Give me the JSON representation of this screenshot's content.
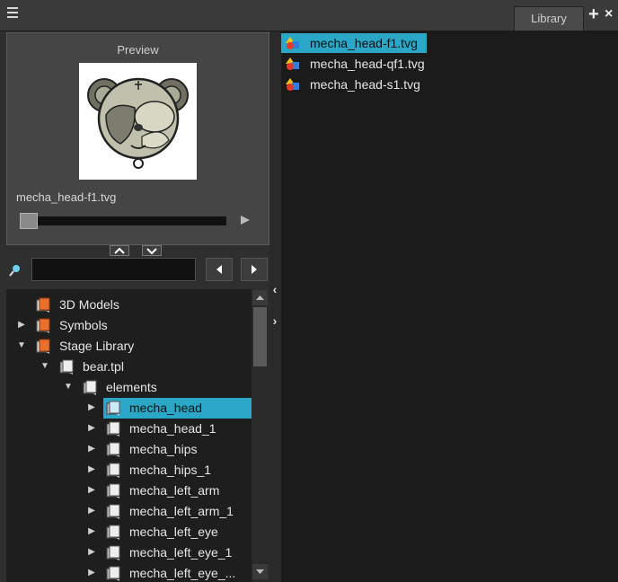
{
  "topbar": {
    "menu_icon": "hamburger-menu-icon",
    "tab_library": "Library",
    "add_label": "+",
    "close_label": "×"
  },
  "preview": {
    "title": "Preview",
    "filename": "mecha_head-f1.tvg",
    "scrubber_progress": 0.0
  },
  "search": {
    "value": "",
    "placeholder": ""
  },
  "tree": {
    "items": [
      {
        "label": "3D Models",
        "depth": 0,
        "expandable": false,
        "expanded": false,
        "icon": "folder-orange-icon",
        "selected": false
      },
      {
        "label": "Symbols",
        "depth": 0,
        "expandable": true,
        "expanded": false,
        "icon": "folder-orange-icon",
        "selected": false
      },
      {
        "label": "Stage Library",
        "depth": 0,
        "expandable": true,
        "expanded": true,
        "icon": "folder-orange-icon",
        "selected": false
      },
      {
        "label": "bear.tpl",
        "depth": 1,
        "expandable": true,
        "expanded": true,
        "icon": "template-icon",
        "selected": false
      },
      {
        "label": "elements",
        "depth": 2,
        "expandable": true,
        "expanded": true,
        "icon": "template-icon",
        "selected": false
      },
      {
        "label": "mecha_head",
        "depth": 3,
        "expandable": true,
        "expanded": false,
        "icon": "template-icon",
        "selected": true
      },
      {
        "label": "mecha_head_1",
        "depth": 3,
        "expandable": true,
        "expanded": false,
        "icon": "template-icon",
        "selected": false
      },
      {
        "label": "mecha_hips",
        "depth": 3,
        "expandable": true,
        "expanded": false,
        "icon": "template-icon",
        "selected": false
      },
      {
        "label": "mecha_hips_1",
        "depth": 3,
        "expandable": true,
        "expanded": false,
        "icon": "template-icon",
        "selected": false
      },
      {
        "label": "mecha_left_arm",
        "depth": 3,
        "expandable": true,
        "expanded": false,
        "icon": "template-icon",
        "selected": false
      },
      {
        "label": "mecha_left_arm_1",
        "depth": 3,
        "expandable": true,
        "expanded": false,
        "icon": "template-icon",
        "selected": false
      },
      {
        "label": "mecha_left_eye",
        "depth": 3,
        "expandable": true,
        "expanded": false,
        "icon": "template-icon",
        "selected": false
      },
      {
        "label": "mecha_left_eye_1",
        "depth": 3,
        "expandable": true,
        "expanded": false,
        "icon": "template-icon",
        "selected": false
      },
      {
        "label": "mecha_left_eye_...",
        "depth": 3,
        "expandable": true,
        "expanded": false,
        "icon": "template-icon",
        "selected": false
      }
    ]
  },
  "files": [
    {
      "label": "mecha_head-f1.tvg",
      "icon": "tvg-file-icon",
      "selected": true
    },
    {
      "label": "mecha_head-qf1.tvg",
      "icon": "tvg-file-icon",
      "selected": false
    },
    {
      "label": "mecha_head-s1.tvg",
      "icon": "tvg-file-icon",
      "selected": false
    }
  ],
  "colors": {
    "selection": "#2aa6c6",
    "folder": "#e8702a"
  }
}
